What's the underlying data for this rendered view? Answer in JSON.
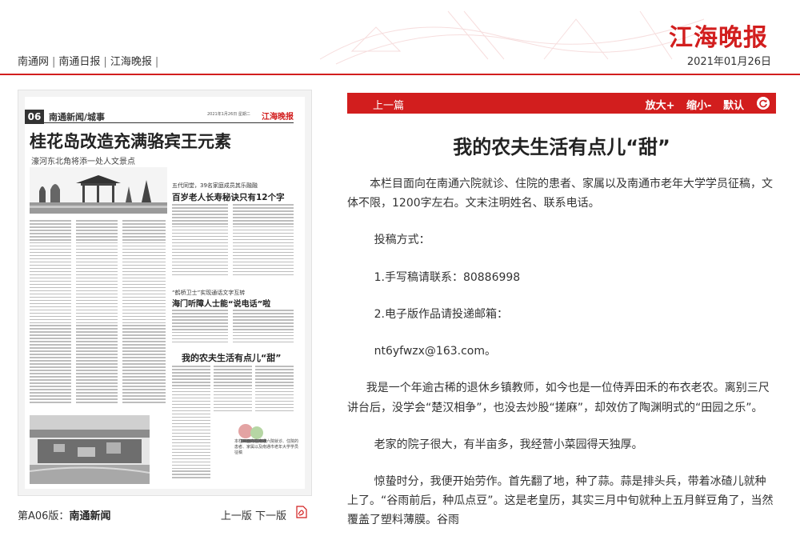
{
  "header": {
    "logo": "江海晚报",
    "nav": [
      "南通网",
      "南通日报",
      "江海晚报"
    ],
    "date": "2021年01月26日"
  },
  "paper": {
    "page_num": "06",
    "section": "南通新闻/城事",
    "date_line": "2021年1月26日 星期二",
    "logo": "江海晚报",
    "headline": "桂花岛改造充满骆宾王元素",
    "subhead": "濠河东北角将添一处人文景点",
    "story2_kicker": "五代同堂，39名家庭成员其乐融融",
    "story2_title": "百岁老人长寿秘诀只有12个字",
    "story3_kicker": "“鹤桥卫士”实现通话文字互转",
    "story3_title": "海门听障人士能“说电话”啦",
    "story4_title": "我的农夫生活有点儿“甜”",
    "credit": "本栏目面向在南通六院就诊、住院的患者、家属以及南通市老年大学学员征稿"
  },
  "paper_footer": {
    "page_label": "第A06版：",
    "page_name": "南通新闻",
    "prev": "上一版",
    "next": "下一版"
  },
  "article": {
    "prev_link": "上一篇",
    "zoom_in": "放大+",
    "zoom_out": "缩小-",
    "default": "默认",
    "title": "我的农夫生活有点儿“甜”",
    "paragraphs": [
      "本栏目面向在南通六院就诊、住院的患者、家属以及南通市老年大学学员征稿，文体不限，1200字左右。文末注明姓名、联系电话。",
      "投稿方式：",
      "1.手写稿请联系：80886998",
      "2.电子版作品请投递邮箱：",
      "nt6yfwzx@163.com。",
      "我是一个年逾古稀的退休乡镇教师，如今也是一位侍弄田禾的布衣老农。离别三尺讲台后，没学会“楚汉相争”，也没去炒股“搓麻”，却效仿了陶渊明式的“田园之乐”。",
      "老家的院子很大，有半亩多，我经营小菜园得天独厚。",
      "惊蛰时分，我便开始劳作。首先翻了地，种了蒜。蒜是排头兵，带着冰碴儿就种上了。“谷雨前后，种瓜点豆”。这是老皇历，其实三月中旬就种上五月鲜豆角了，当然覆盖了塑料薄膜。谷雨"
    ]
  },
  "colors": {
    "brand_red": "#d21e1e"
  }
}
